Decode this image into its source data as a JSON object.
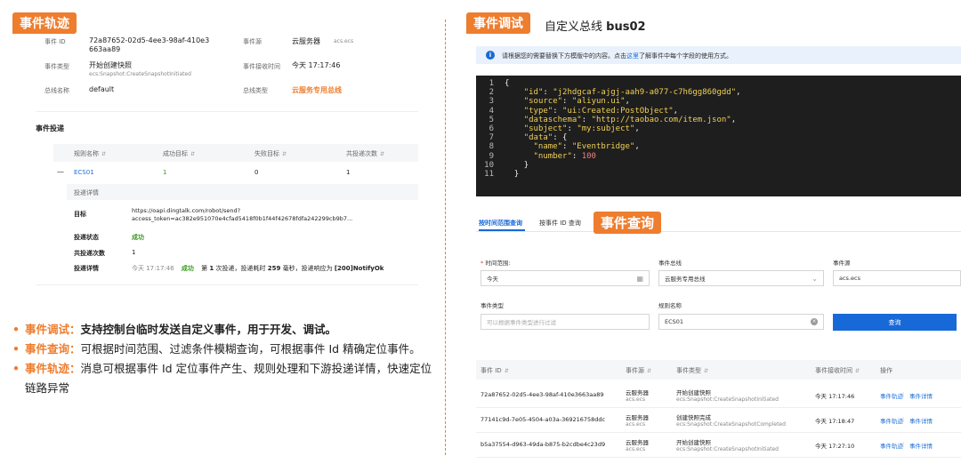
{
  "left": {
    "badge": "事件轨迹",
    "detail": {
      "event_id_label": "事件 ID",
      "event_id_value": "72a87652-02d5-4ee3-98af-410e3663aa89",
      "event_source_label": "事件源",
      "event_source_value": "云服务器",
      "event_source_sub": "acs.ecs",
      "event_type_label": "事件类型",
      "event_type_value": "开始创建快照",
      "event_type_sub": "ecs:Snapshot:CreateSnapshotInitiated",
      "receive_time_label": "事件接收时间",
      "receive_time_value": "今天 17:17:46",
      "bus_name_label": "总线名称",
      "bus_name_value": "default",
      "bus_type_label": "总线类型",
      "bus_type_value": "云服务专用总线"
    },
    "delivery": {
      "title": "事件投递",
      "headers": [
        "规则名称",
        "成功目标",
        "失败目标",
        "共投递次数"
      ],
      "row": {
        "expand": "—",
        "rule": "ECS01",
        "success": "1",
        "fail": "0",
        "count": "1"
      },
      "details_title": "投递详情",
      "target_label": "目标",
      "target_value_1": "https://oapi.dingtalk.com/robot/send?",
      "target_value_2": "access_token=ac382e951070e4cfad5418f0b1f44f42678fdfa242299cb9b7...",
      "status_label": "投递状态",
      "status_value": "成功",
      "count_label": "共投递次数",
      "count_value": "1",
      "detail_label": "投递详情",
      "detail_time": "今天 17:17:46",
      "detail_status": "成功",
      "detail_text_a": "第",
      "detail_num1": "1",
      "detail_text_b": "次投递，投递耗时",
      "detail_num2": "259",
      "detail_text_c": "毫秒，投递响应为",
      "detail_resp": "[200]NotifyOk"
    },
    "bullets": [
      {
        "title": "事件调试：",
        "text": "支持控制台临时发送自定义事件，用于开发、调试。",
        "bold": true
      },
      {
        "title": "事件查询：",
        "text": "可根据时间范围、过滤条件模糊查询，可根据事件 Id 精确定位事件。",
        "bold": false
      },
      {
        "title": "事件轨迹：",
        "text": "消息可根据事件 Id 定位事件产生、规则处理和下游投递详情，快速定位链路异常",
        "bold": false
      }
    ]
  },
  "right": {
    "debug_badge": "事件调试",
    "title_prefix": "自定义总线",
    "title_bus": "bus02",
    "notice_icon": "info-icon",
    "notice_text_a": "请根据您的需要替换下方模版中的内容。点击",
    "notice_link": "这里",
    "notice_text_b": "了解事件中每个字段的使用方式。",
    "code_lines": [
      {
        "n": "1",
        "ind": "",
        "k": "",
        "v": "",
        "p": "{"
      },
      {
        "n": "2",
        "ind": "    ",
        "k": "\"id\"",
        "v": "\"j2hdgcaf-ajgj-aah9-a077-c7h6gg860gdd\"",
        "p": ","
      },
      {
        "n": "3",
        "ind": "    ",
        "k": "\"source\"",
        "v": "\"aliyun.ui\"",
        "p": ","
      },
      {
        "n": "4",
        "ind": "    ",
        "k": "\"type\"",
        "v": "\"ui:Created:PostObject\"",
        "p": ","
      },
      {
        "n": "5",
        "ind": "    ",
        "k": "\"dataschema\"",
        "v": "\"http://taobao.com/item.json\"",
        "p": ","
      },
      {
        "n": "6",
        "ind": "    ",
        "k": "\"subject\"",
        "v": "\"my:subject\"",
        "p": ","
      },
      {
        "n": "7",
        "ind": "    ",
        "k": "\"data\"",
        "v": "",
        "p": ": {"
      },
      {
        "n": "8",
        "ind": "      ",
        "k": "\"name\"",
        "v": "\"Eventbridge\"",
        "p": ","
      },
      {
        "n": "9",
        "ind": "      ",
        "k": "\"number\"",
        "v": "",
        "num": "100",
        "p": ""
      },
      {
        "n": "10",
        "ind": "    ",
        "k": "",
        "v": "",
        "p": "}"
      },
      {
        "n": "11",
        "ind": "  ",
        "k": "",
        "v": "",
        "p": "}"
      }
    ],
    "tabs": [
      "按时间范围查询",
      "按事件 ID 查询"
    ],
    "query_badge": "事件查询",
    "form": {
      "time_label": "时间范围:",
      "time_value": "今天",
      "bus_label": "事件总线",
      "bus_value": "云服务专用总线",
      "source_label": "事件源",
      "source_value": "acs.ecs",
      "type_label": "事件类型",
      "type_placeholder": "可以根据事件类型进行过滤",
      "rule_label": "规则名称",
      "rule_value": "ECS01",
      "query_button": "查询"
    },
    "table": {
      "headers": [
        "事件 ID",
        "事件源",
        "事件类型",
        "事件接收时间",
        "操作"
      ],
      "op_trace": "事件轨迹",
      "op_detail": "事件详情",
      "rows": [
        {
          "id": "72a87652-02d5-4ee3-98af-410e3663aa89",
          "src": "云服务器",
          "src_sub": "acs.ecs",
          "type": "开始创建快照",
          "type_sub": "ecs:Snapshot:CreateSnapshotInitiated",
          "time": "今天 17:17:46"
        },
        {
          "id": "77141c9d-7e05-4504-a03a-369216758ddc",
          "src": "云服务器",
          "src_sub": "acs.ecs",
          "type": "创建快照完成",
          "type_sub": "ecs:Snapshot:CreateSnapshotCompleted",
          "time": "今天 17:18:47"
        },
        {
          "id": "b5a37554-d963-49da-b875-b2cdbe4c23d9",
          "src": "云服务器",
          "src_sub": "acs.ecs",
          "type": "开始创建快照",
          "type_sub": "ecs:Snapshot:CreateSnapshotInitiated",
          "time": "今天 17:27:10"
        }
      ]
    }
  },
  "colors": {
    "accent": "#ee7d2e",
    "link": "#1e6fd9",
    "success": "#3a9a1e",
    "button": "#1769d8"
  }
}
